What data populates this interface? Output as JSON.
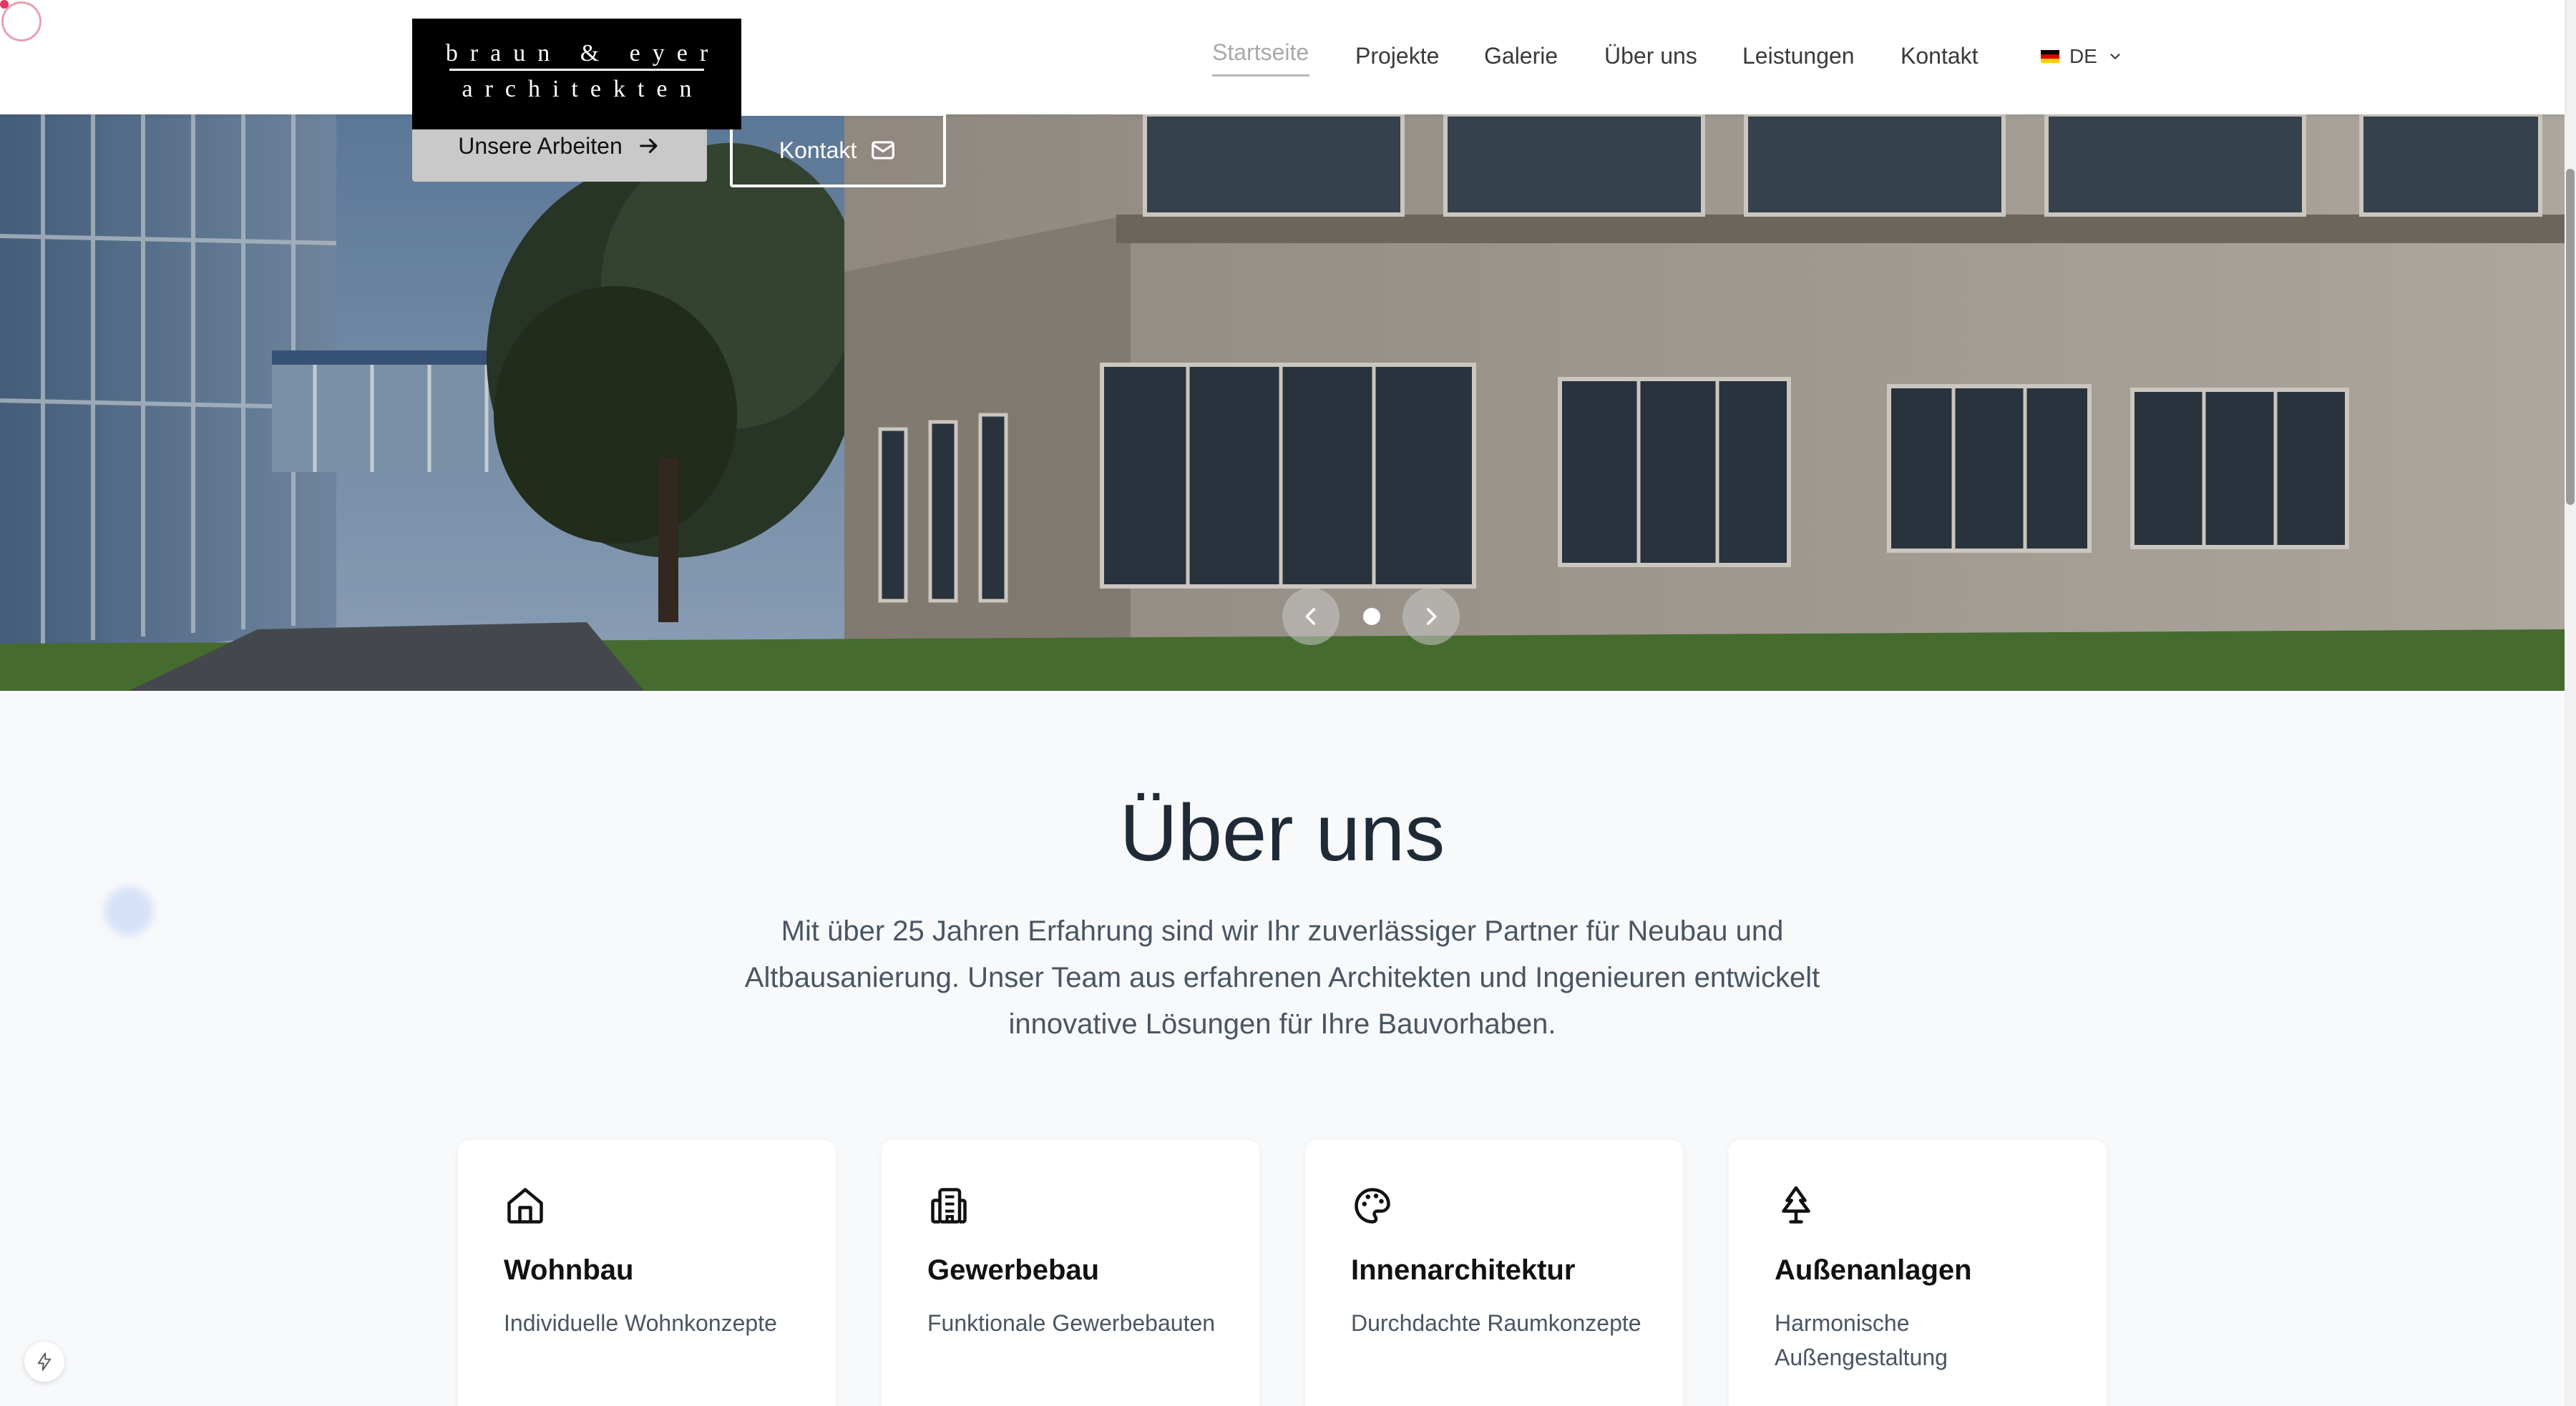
{
  "logo": {
    "line1": "braun & eyer",
    "line2": "architekten"
  },
  "nav": {
    "items": [
      {
        "label": "Startseite",
        "active": true
      },
      {
        "label": "Projekte"
      },
      {
        "label": "Galerie"
      },
      {
        "label": "Über uns"
      },
      {
        "label": "Leistungen"
      },
      {
        "label": "Kontakt"
      }
    ],
    "language": {
      "code": "DE",
      "flag_colors": [
        "#000000",
        "#dd0000",
        "#ffce00"
      ]
    }
  },
  "hero": {
    "primary_button": "Unsere Arbeiten",
    "secondary_button": "Kontakt",
    "slide_count": 1,
    "active_slide": 1
  },
  "about": {
    "title": "Über uns",
    "text": "Mit über 25 Jahren Erfahrung sind wir Ihr zuverlässiger Partner für Neubau und Altbausanierung. Unser Team aus erfahrenen Architekten und Ingenieuren entwickelt innovative Lösungen für Ihre Bauvorhaben."
  },
  "services": [
    {
      "icon": "house-icon",
      "title": "Wohnbau",
      "desc": "Individuelle Wohnkonzepte"
    },
    {
      "icon": "building-icon",
      "title": "Gewerbebau",
      "desc": "Funktionale Gewerbebauten"
    },
    {
      "icon": "palette-icon",
      "title": "Innenarchitektur",
      "desc": "Durchdachte Raumkonzepte"
    },
    {
      "icon": "tree-icon",
      "title": "Außenanlagen",
      "desc": "Harmonische Außengestaltung"
    }
  ],
  "colors": {
    "header_bg": "#ffffff",
    "logo_bg": "#000000",
    "primary_button_bg": "#c9c9c9",
    "text_dark": "#1f2a37",
    "text_muted": "#4a5563",
    "page_bg": "#f8f9fb"
  }
}
